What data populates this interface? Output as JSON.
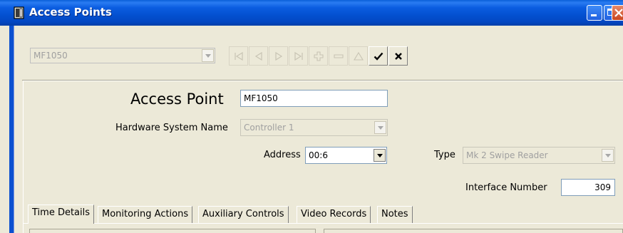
{
  "window": {
    "title": "Access Points"
  },
  "toolbar": {
    "record_selector": "MF1050"
  },
  "form": {
    "access_point_label": "Access Point",
    "access_point_value": "MF1050",
    "hardware_label": "Hardware System Name",
    "hardware_value": "Controller 1",
    "address_label": "Address",
    "address_value": "00:6",
    "type_label": "Type",
    "type_value": "Mk 2 Swipe Reader",
    "interface_label": "Interface Number",
    "interface_value": "309"
  },
  "tabs": [
    {
      "label": "Time Details",
      "active": true
    },
    {
      "label": "Monitoring Actions",
      "active": false
    },
    {
      "label": "Auxiliary Controls",
      "active": false
    },
    {
      "label": "Video Records",
      "active": false
    },
    {
      "label": "Notes",
      "active": false
    }
  ],
  "colors": {
    "titlebar": "#0350d0",
    "window_face": "#ECE9D8",
    "close_button": "#c8451f"
  }
}
